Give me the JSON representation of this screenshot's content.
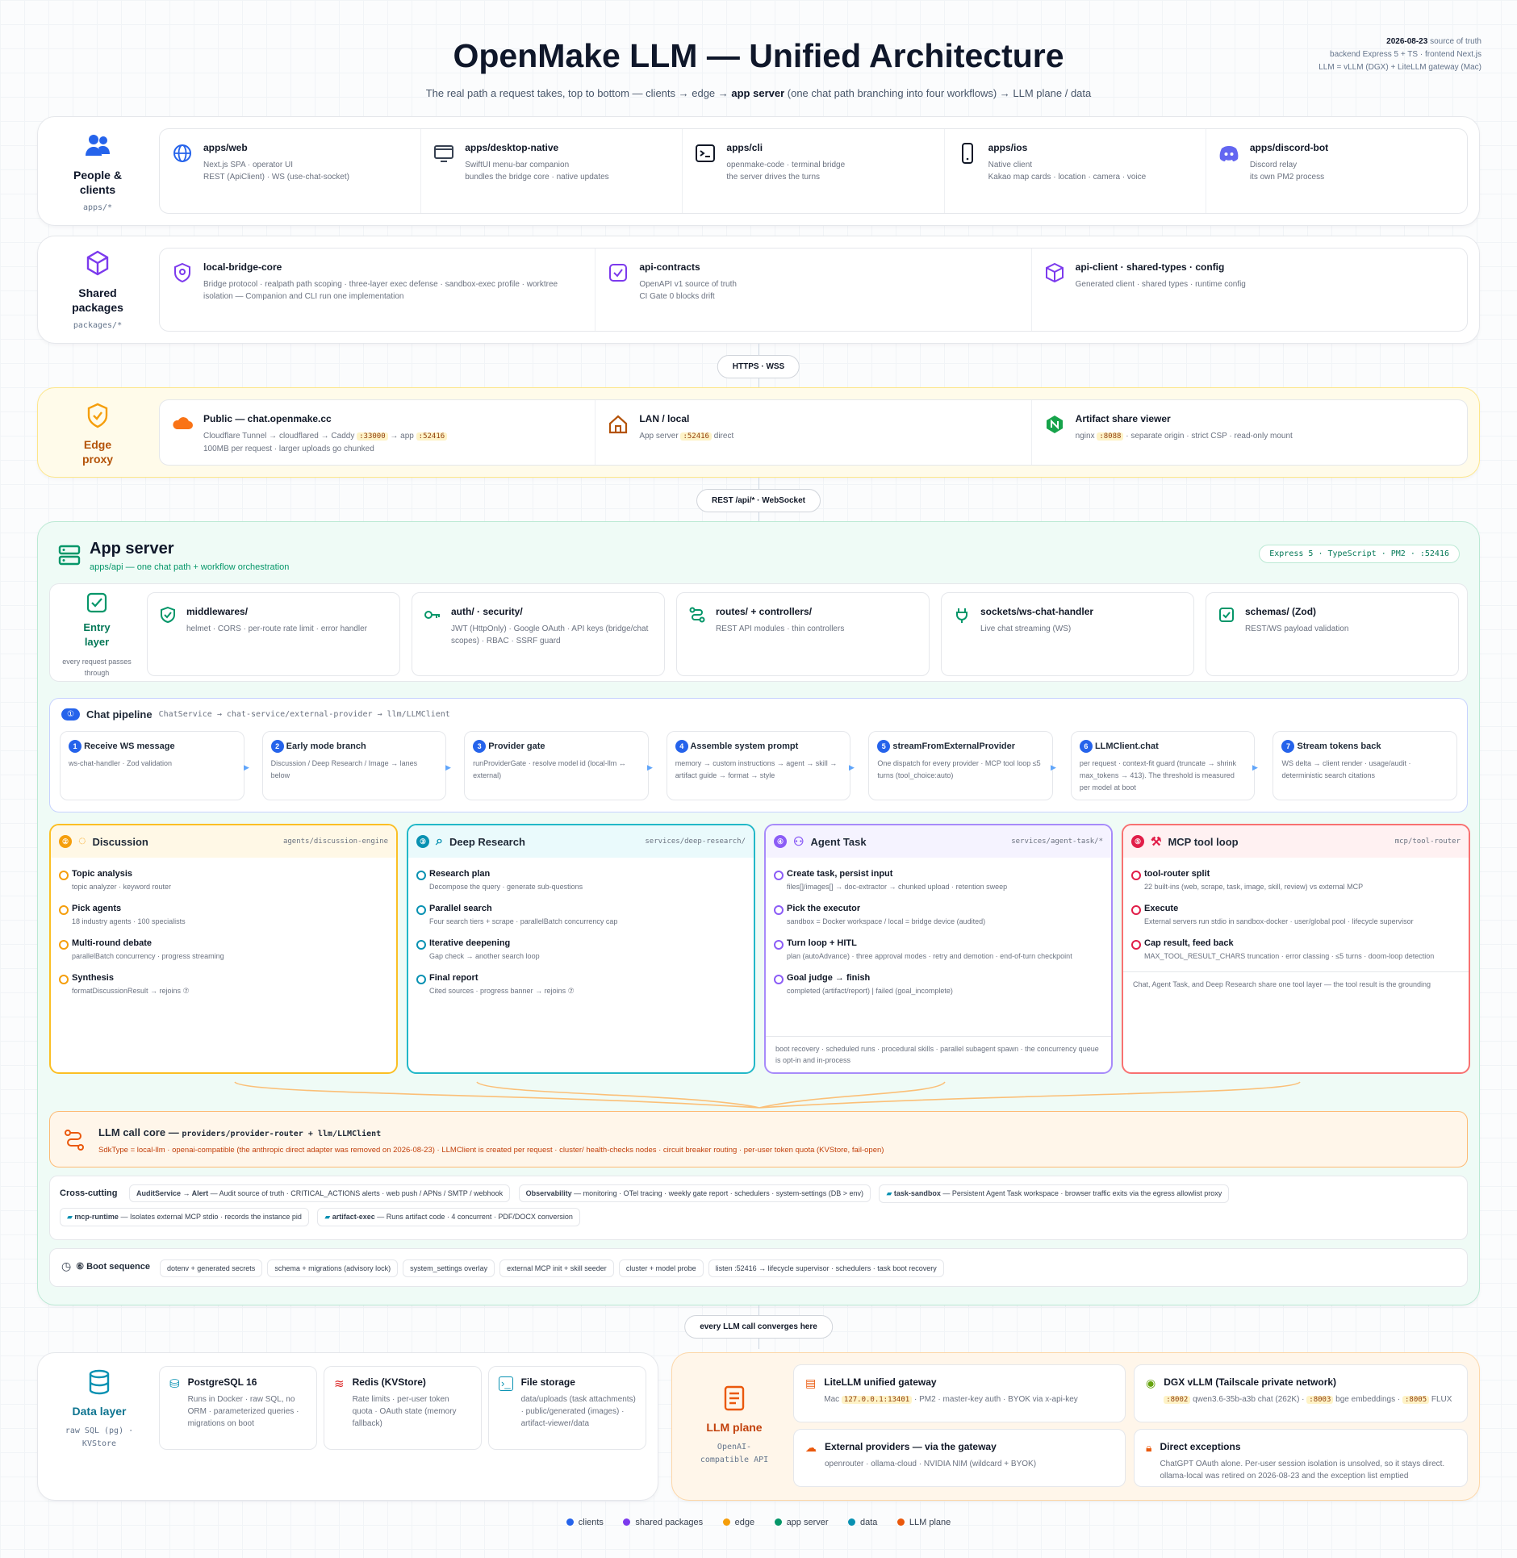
{
  "header": {
    "title": "OpenMake LLM — Unified Architecture",
    "subtitle_a": "The real path a request takes, top to bottom — clients → edge → ",
    "subtitle_b": "app server",
    "subtitle_c": " (one chat path branching into four workflows) → LLM plane / data",
    "meta_date": "2026-08-23",
    "meta_date_suffix": " source of truth",
    "meta_l2": "backend Express 5 + TS · frontend Next.js",
    "meta_l3": "LLM = vLLM (DGX) + LiteLLM gateway (Mac)"
  },
  "clients": {
    "label": "People & clients",
    "sub": "apps/*",
    "items": [
      {
        "title": "apps/web",
        "l1": "Next.js SPA · operator UI",
        "l2": "REST (ApiClient) · WS (use-chat-socket)"
      },
      {
        "title": "apps/desktop-native",
        "l1": "SwiftUI menu-bar companion",
        "l2": "bundles the bridge core · native updates"
      },
      {
        "title": "apps/cli",
        "l1": "openmake-code · terminal bridge",
        "l2": "the server drives the turns"
      },
      {
        "title": "apps/ios",
        "l1": "Native client",
        "l2": "Kakao map cards · location · camera · voice"
      },
      {
        "title": "apps/discord-bot",
        "l1": "Discord relay",
        "l2": "its own PM2 process"
      }
    ]
  },
  "packages": {
    "label": "Shared packages",
    "sub": "packages/*",
    "items": [
      {
        "title": "local-bridge-core",
        "l1": "Bridge protocol · realpath path scoping · three-layer exec defense · sandbox-exec profile · worktree",
        "l2": "isolation — Companion and CLI run one implementation"
      },
      {
        "title": "api-contracts",
        "l1": "OpenAPI v1 source of truth",
        "l2": "CI Gate 0 blocks drift"
      },
      {
        "title": "api-client · shared-types · config",
        "l1": "Generated client · shared types · runtime config",
        "l2": ""
      }
    ]
  },
  "pill1": "HTTPS · WSS",
  "edge": {
    "label": "Edge proxy",
    "public": {
      "title": "Public — chat.openmake.cc",
      "a": "Cloudflare Tunnel → cloudflared → Caddy ",
      "t1": ":33000",
      "b": " → app ",
      "t2": ":52416",
      "l2": "100MB per request · larger uploads go chunked"
    },
    "lan": {
      "title": "LAN / local",
      "a": "App server ",
      "t1": ":52416",
      "b": " direct"
    },
    "artifact": {
      "title": "Artifact share viewer",
      "a": "nginx ",
      "t1": ":8088",
      "b": " · separate origin · strict CSP · read-only mount"
    }
  },
  "pill2": "REST /api/* · WebSocket",
  "app": {
    "title": "App server",
    "sub": "apps/api — one chat path + workflow orchestration",
    "badge": "Express 5 · TypeScript · PM2 · :52416",
    "entry": {
      "label": "Entry layer",
      "sub": "every request passes through",
      "items": [
        {
          "title": "middlewares/",
          "d": "helmet · CORS · per-route rate limit · error handler"
        },
        {
          "title": "auth/ · security/",
          "d": "JWT (HttpOnly) · Google OAuth · API keys (bridge/chat scopes) · RBAC · SSRF guard"
        },
        {
          "title": "routes/ + controllers/",
          "d": "REST API modules · thin controllers"
        },
        {
          "title": "sockets/ws-chat-handler",
          "d": "Live chat streaming (WS)"
        },
        {
          "title": "schemas/ (Zod)",
          "d": "REST/WS payload validation"
        }
      ]
    },
    "pipeline": {
      "num": "①",
      "title": "Chat pipeline",
      "path": "ChatService → chat-service/external-provider → llm/LLMClient",
      "steps": [
        {
          "n": "1",
          "title": "Receive WS message",
          "d": "ws-chat-handler · Zod validation"
        },
        {
          "n": "2",
          "title": "Early mode branch",
          "d": "Discussion / Deep Research / Image → lanes below"
        },
        {
          "n": "3",
          "title": "Provider gate",
          "d": "runProviderGate · resolve model id (local-llm ↔ external)"
        },
        {
          "n": "4",
          "title": "Assemble system prompt",
          "d": "memory → custom instructions → agent → skill → artifact guide → format → style"
        },
        {
          "n": "5",
          "title": "streamFromExternalProvider",
          "d": "One dispatch for every provider · MCP tool loop ≤5 turns (tool_choice:auto)"
        },
        {
          "n": "6",
          "title": "LLMClient.chat",
          "d": "per request · context-fit guard (truncate → shrink max_tokens → 413). The threshold is measured per model at boot"
        },
        {
          "n": "7",
          "title": "Stream tokens back",
          "d": "WS delta → client render · usage/audit · deterministic search citations"
        }
      ]
    },
    "workflows": [
      {
        "num": "②",
        "title": "Discussion",
        "path": "agents/discussion-engine",
        "steps": [
          {
            "t": "Topic analysis",
            "d": "topic analyzer · keyword router"
          },
          {
            "t": "Pick agents",
            "d": "18 industry agents · 100 specialists"
          },
          {
            "t": "Multi-round debate",
            "d": "parallelBatch concurrency · progress streaming"
          },
          {
            "t": "Synthesis",
            "d": "formatDiscussionResult → rejoins ⑦"
          }
        ],
        "foot": ""
      },
      {
        "num": "③",
        "title": "Deep Research",
        "path": "services/deep-research/",
        "steps": [
          {
            "t": "Research plan",
            "d": "Decompose the query · generate sub-questions"
          },
          {
            "t": "Parallel search",
            "d": "Four search tiers + scrape · parallelBatch concurrency cap"
          },
          {
            "t": "Iterative deepening",
            "d": "Gap check → another search loop"
          },
          {
            "t": "Final report",
            "d": "Cited sources · progress banner → rejoins ⑦"
          }
        ],
        "foot": ""
      },
      {
        "num": "④",
        "title": "Agent Task",
        "path": "services/agent-task/*",
        "steps": [
          {
            "t": "Create task, persist input",
            "d": "files[]/images[] → doc-extractor → chunked upload · retention sweep"
          },
          {
            "t": "Pick the executor",
            "d": "sandbox = Docker workspace / local = bridge device (audited)"
          },
          {
            "t": "Turn loop + HITL",
            "d": "plan (autoAdvance) · three approval modes · retry and demotion · end-of-turn checkpoint"
          },
          {
            "t": "Goal judge → finish",
            "d": "completed (artifact/report) | failed (goal_incomplete)"
          }
        ],
        "foot": "boot recovery · scheduled runs · procedural skills · parallel subagent spawn · the concurrency queue is opt-in and in-process"
      },
      {
        "num": "⑤",
        "title": "MCP tool loop",
        "path": "mcp/tool-router",
        "steps": [
          {
            "t": "tool-router split",
            "d": "22 built-ins (web, scrape, task, image, skill, review) vs external MCP"
          },
          {
            "t": "Execute",
            "d": "External servers run stdio in sandbox-docker · user/global pool · lifecycle supervisor"
          },
          {
            "t": "Cap result, feed back",
            "d": "MAX_TOOL_RESULT_CHARS truncation · error classing · ≤5 turns · doom-loop detection"
          }
        ],
        "foot": "Chat, Agent Task, and Deep Research share one tool layer — the tool result is the grounding"
      }
    ],
    "llmcore": {
      "title": "LLM call core — ",
      "code": "providers/provider-router + llm/LLMClient",
      "d": "SdkType = local-llm · openai-compatible (the anthropic direct adapter was removed on 2026-08-23) · LLMClient is created per request · cluster/ health-checks nodes · circuit breaker routing · per-user token quota (KVStore, fail-open)"
    },
    "cross": {
      "label": "Cross-cutting",
      "items": [
        {
          "b": "AuditService → Alert",
          "t": " — Audit source of truth · CRITICAL_ACTIONS alerts · web push / APNs / SMTP / webhook"
        },
        {
          "b": "Observability",
          "t": " — monitoring · OTel tracing · weekly gate report · schedulers · system-settings (DB > env)"
        },
        {
          "b": "task-sandbox",
          "t": " — Persistent Agent Task workspace · browser traffic exits via the egress allowlist proxy"
        },
        {
          "b": "mcp-runtime",
          "t": " — Isolates external MCP stdio · records the instance pid"
        },
        {
          "b": "artifact-exec",
          "t": " — Runs artifact code · 4 concurrent · PDF/DOCX conversion"
        }
      ]
    },
    "boot": {
      "label": "⑥ Boot sequence",
      "items": [
        "dotenv + generated secrets",
        "schema + migrations (advisory lock)",
        "system_settings overlay",
        "external MCP init + skill seeder",
        "cluster + model probe",
        "listen :52416 → lifecycle supervisor · schedulers · task boot recovery"
      ]
    }
  },
  "pill3": "every LLM call converges here",
  "data": {
    "label": "Data layer",
    "sub": "raw SQL (pg) · KVStore",
    "items": [
      {
        "title": "PostgreSQL 16",
        "d": "Runs in Docker · raw SQL, no ORM · parameterized queries · migrations on boot"
      },
      {
        "title": "Redis (KVStore)",
        "d": "Rate limits · per-user token quota · OAuth state (memory fallback)"
      },
      {
        "title": "File storage",
        "d": "data/uploads (task attachments) · public/generated (images) · artifact-viewer/data"
      }
    ]
  },
  "llm": {
    "label": "LLM plane",
    "sub": "OpenAI-compatible API",
    "litellm": {
      "title": "LiteLLM unified gateway",
      "a": "Mac ",
      "t1": "127.0.0.1:13401",
      "b": " · PM2 · master-key auth · BYOK via x-api-key"
    },
    "dgx": {
      "title": "DGX vLLM (Tailscale private network)",
      "t1": ":8002",
      "a": " qwen3.6-35b-a3b chat (262K) · ",
      "t2": ":8003",
      "b": " bge embeddings · ",
      "t3": ":8005",
      "c": " FLUX"
    },
    "external": {
      "title": "External providers — via the gateway",
      "d": "openrouter · ollama-cloud · NVIDIA NIM (wildcard + BYOK)"
    },
    "exceptions": {
      "title": "Direct exceptions",
      "d": "ChatGPT OAuth alone. Per-user session isolation is unsolved, so it stays direct. ollama-local was retired on 2026-08-23 and the exception list emptied"
    }
  },
  "legend": [
    {
      "label": "clients",
      "color": "#2563eb"
    },
    {
      "label": "shared packages",
      "color": "#7c3aed"
    },
    {
      "label": "edge",
      "color": "#f59e0b"
    },
    {
      "label": "app server",
      "color": "#059669"
    },
    {
      "label": "data",
      "color": "#0891b2"
    },
    {
      "label": "LLM plane",
      "color": "#ea580c"
    }
  ]
}
